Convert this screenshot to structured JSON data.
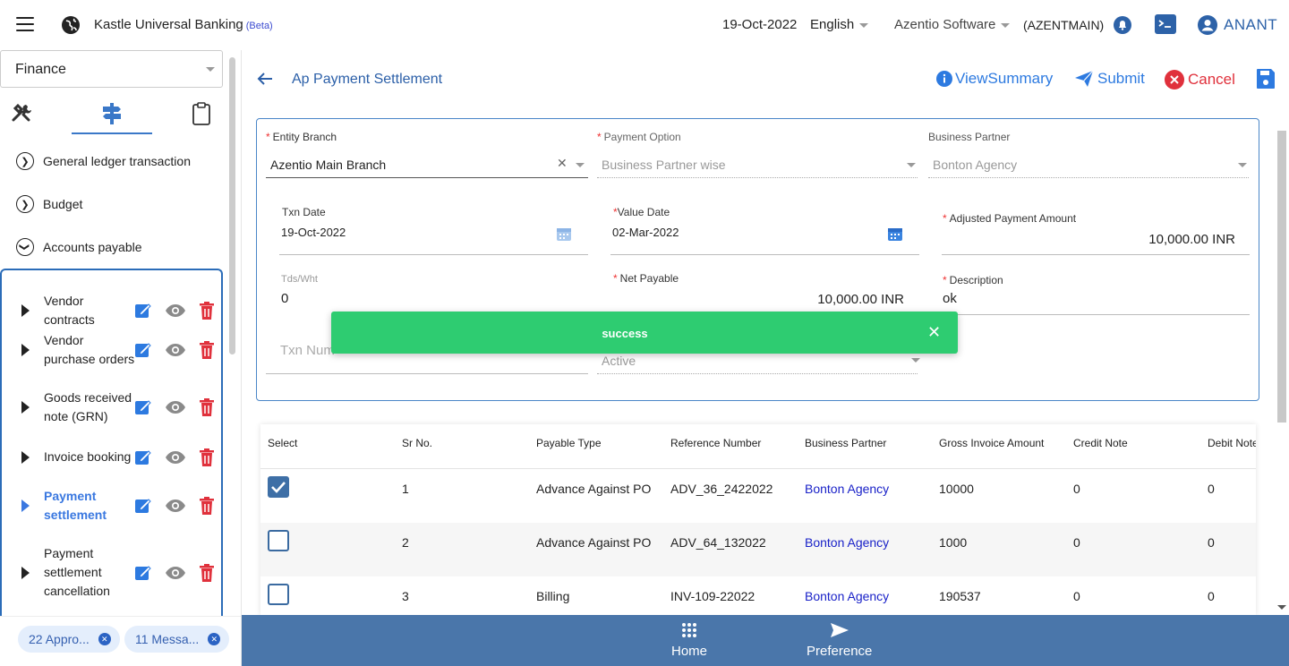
{
  "topbar": {
    "app_title": "Kastle Universal Banking",
    "app_badge": "(Beta)",
    "date": "19-Oct-2022",
    "language": "English",
    "company": "Azentio Software",
    "company_code": "(AZENTMAIN)",
    "user": "ANANT"
  },
  "sidebar": {
    "module": "Finance",
    "nav": [
      "General ledger transaction",
      "Budget",
      "Accounts payable"
    ],
    "ap_items": [
      {
        "label": "Vendor contracts",
        "active": false
      },
      {
        "label": "Vendor purchase orders",
        "active": false
      },
      {
        "label": "Goods received note (GRN)",
        "active": false
      },
      {
        "label": "Invoice booking",
        "active": false
      },
      {
        "label": "Payment settlement",
        "active": true
      },
      {
        "label": "Payment settlement cancellation",
        "active": false
      }
    ],
    "chips": [
      "22 Appro...",
      "11 Messa..."
    ]
  },
  "page": {
    "title": "Ap Payment Settlement",
    "view_summary": "ViewSummary",
    "submit": "Submit",
    "cancel": "Cancel"
  },
  "form": {
    "entity_branch": {
      "label": "Entity Branch",
      "value": "Azentio Main Branch"
    },
    "payment_option": {
      "label": "Payment Option",
      "value": "Business Partner wise"
    },
    "business_partner": {
      "label": "Business Partner",
      "value": "Bonton Agency"
    },
    "txn_date": {
      "label": "Txn Date",
      "value": "19-Oct-2022"
    },
    "value_date": {
      "label": "Value Date",
      "value": "02-Mar-2022"
    },
    "adjusted_amount": {
      "label": "Adjusted Payment Amount",
      "value": "10,000.00 INR"
    },
    "tds": {
      "label": "Tds/Wht",
      "value": "0"
    },
    "net_payable": {
      "label": "Net Payable",
      "value": "10,000.00 INR"
    },
    "description": {
      "label": "Description",
      "value": "ok"
    },
    "txn_number": {
      "placeholder": "Txn Num"
    },
    "status": {
      "value": "Active"
    }
  },
  "toast": {
    "message": "success"
  },
  "table": {
    "headers": [
      "Select",
      "Sr No.",
      "Payable Type",
      "Reference Number",
      "Business Partner",
      "Gross Invoice Amount",
      "Credit Note",
      "Debit Note"
    ],
    "rows": [
      {
        "selected": true,
        "sr": "1",
        "type": "Advance Against PO",
        "ref": "ADV_36_2422022",
        "partner": "Bonton Agency",
        "gross": "10000",
        "credit": "0",
        "debit": "0"
      },
      {
        "selected": false,
        "sr": "2",
        "type": "Advance Against PO",
        "ref": "ADV_64_132022",
        "partner": "Bonton Agency",
        "gross": "1000",
        "credit": "0",
        "debit": "0"
      },
      {
        "selected": false,
        "sr": "3",
        "type": "Billing",
        "ref": "INV-109-22022",
        "partner": "Bonton Agency",
        "gross": "190537",
        "credit": "0",
        "debit": "0"
      }
    ]
  },
  "bottom_nav": {
    "home": "Home",
    "preference": "Preference"
  }
}
